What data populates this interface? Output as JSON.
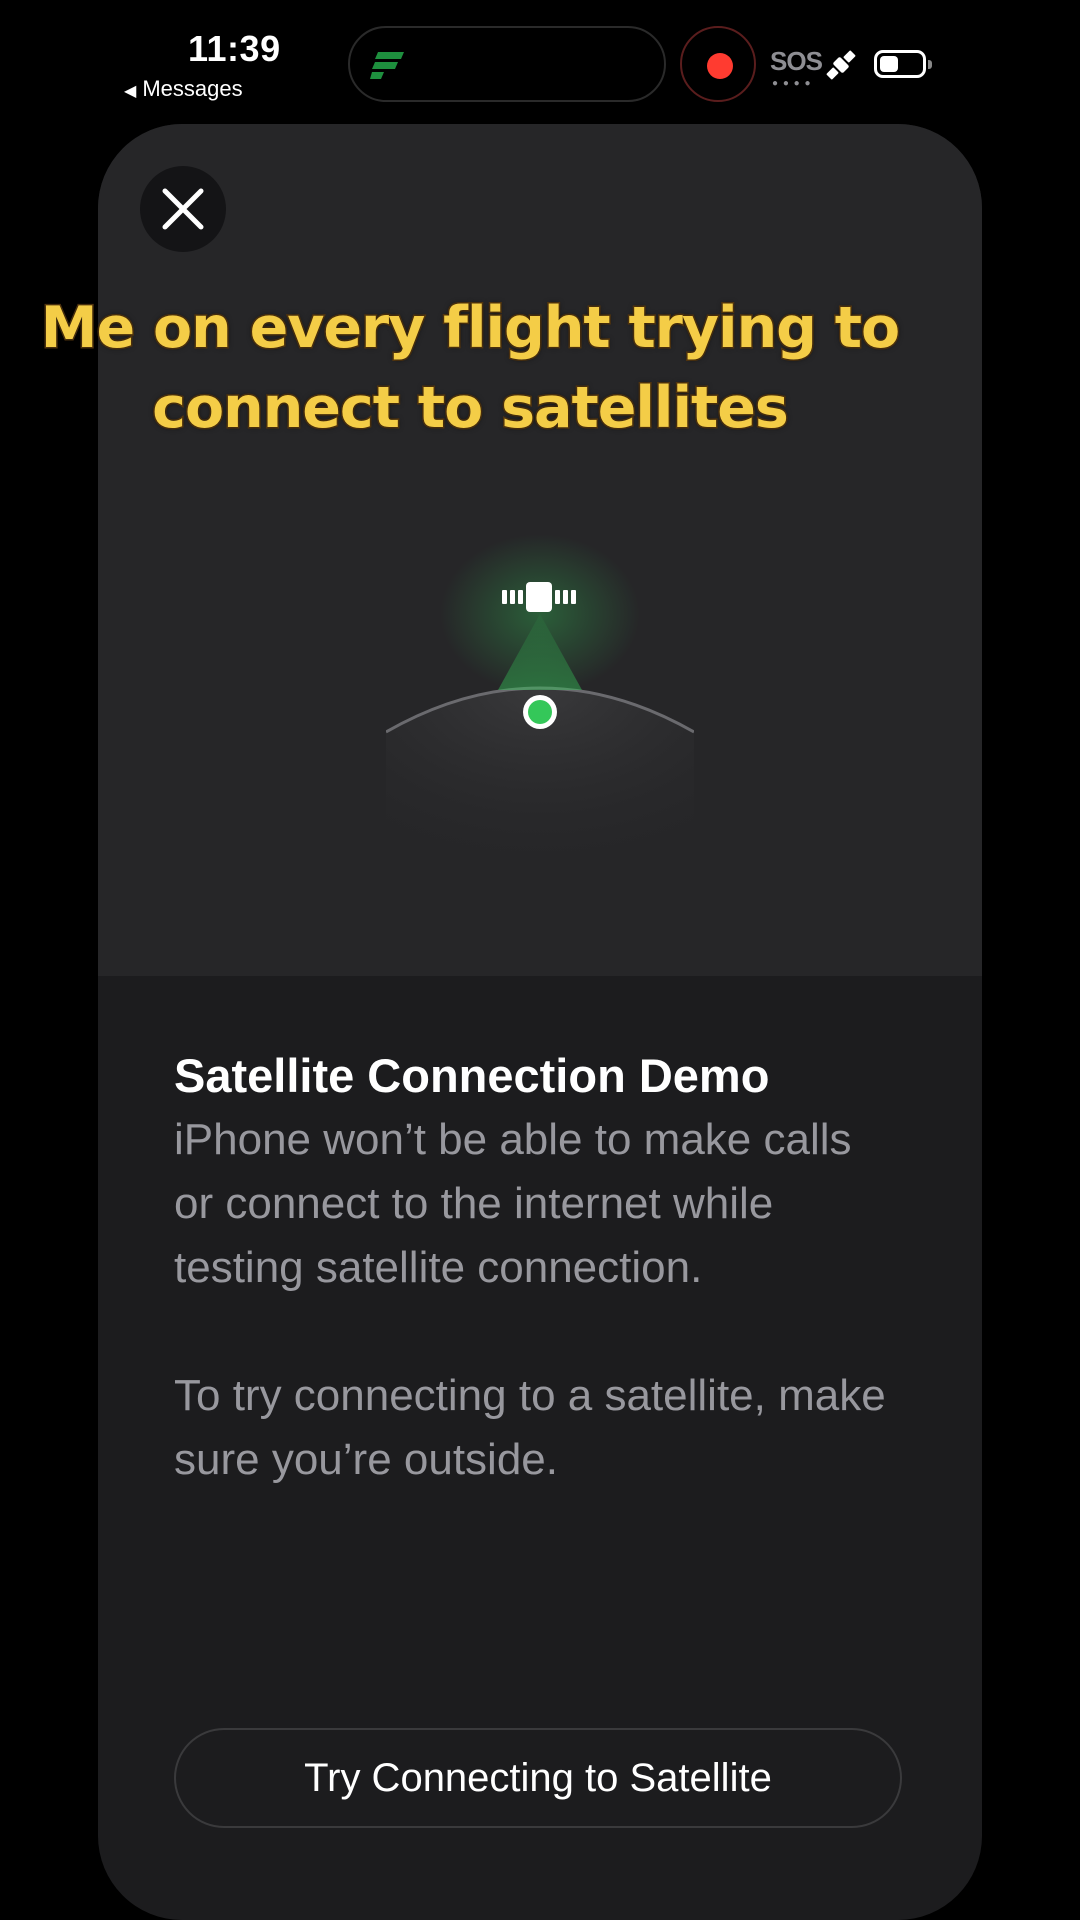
{
  "status_bar": {
    "time": "11:39",
    "back_app": "Messages",
    "sos_label": "SOS",
    "recording_color": "#ff3b30"
  },
  "caption": {
    "line1": "Me on every flight trying to",
    "line2": "connect to satellites"
  },
  "sheet": {
    "close_icon": "close-icon",
    "title": "Satellite Connection Demo",
    "body_paragraph_1": "iPhone won’t be able to make calls or connect to the internet while testing satellite connection.",
    "body_paragraph_2": "To try connecting to a satellite, make sure you’re outside.",
    "primary_button": "Try Connecting to Satellite",
    "accent_color": "#34c759"
  }
}
